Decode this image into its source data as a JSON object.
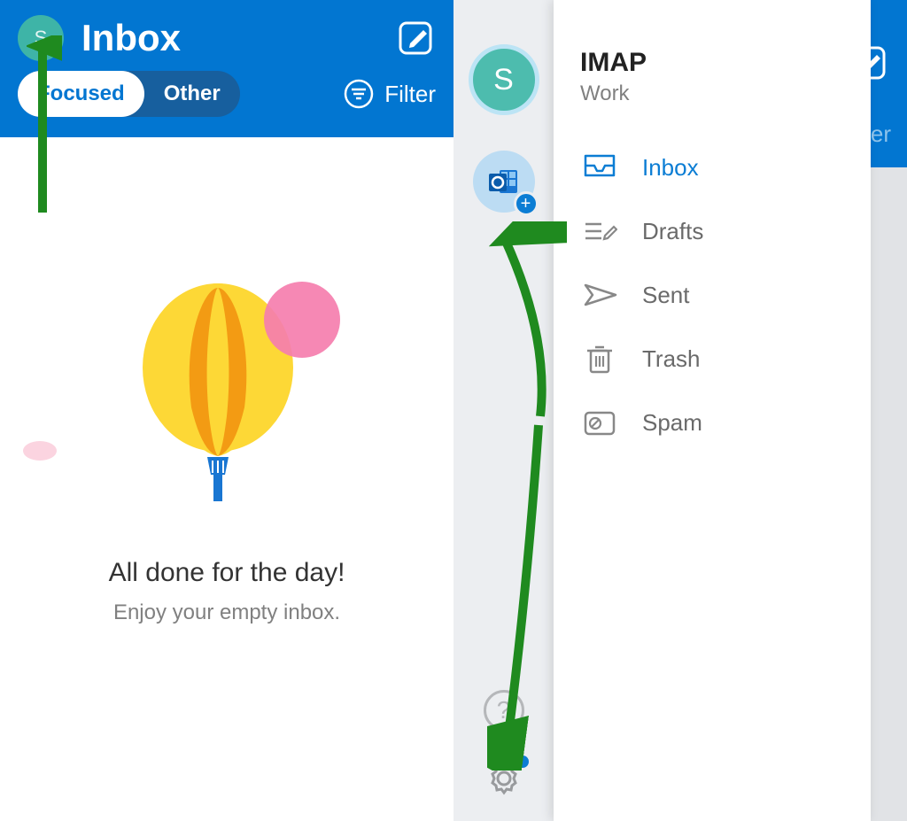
{
  "colors": {
    "brand": "#0276d1",
    "accent": "#0b7dd4",
    "avatar": "#4dbcae"
  },
  "left": {
    "avatar_initial": "S",
    "title": "Inbox",
    "tabs": {
      "focused": "Focused",
      "other": "Other"
    },
    "filter_label": "Filter",
    "empty_title": "All done for the day!",
    "empty_sub": "Enjoy your empty inbox."
  },
  "right": {
    "bg_filter_partial": "ter",
    "rail": {
      "avatar_initial": "S",
      "add_plus": "+",
      "help_label": "?"
    },
    "account": {
      "name": "IMAP",
      "type": "Work"
    },
    "folders": [
      {
        "key": "inbox",
        "label": "Inbox",
        "active": true
      },
      {
        "key": "drafts",
        "label": "Drafts",
        "active": false
      },
      {
        "key": "sent",
        "label": "Sent",
        "active": false
      },
      {
        "key": "trash",
        "label": "Trash",
        "active": false
      },
      {
        "key": "spam",
        "label": "Spam",
        "active": false
      }
    ]
  }
}
